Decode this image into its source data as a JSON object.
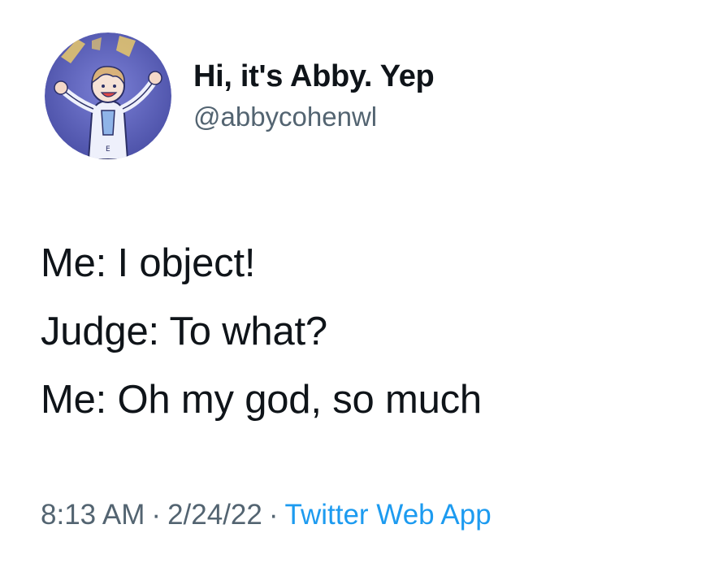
{
  "tweet": {
    "author": {
      "display_name": "Hi, it's Abby. Yep",
      "handle": "@abbycohenwl",
      "avatar_icon": "cartoon-character-avatar-icon"
    },
    "text_lines": [
      "Me: I object!",
      "Judge: To what?",
      "Me: Oh my god, so much"
    ],
    "meta": {
      "time": "8:13 AM",
      "separator": "·",
      "date": "2/24/22",
      "source": "Twitter Web App"
    }
  },
  "colors": {
    "text_primary": "#0f1419",
    "text_secondary": "#536471",
    "link_blue": "#1d9bf0",
    "avatar_bg": "#5a5fb8"
  }
}
